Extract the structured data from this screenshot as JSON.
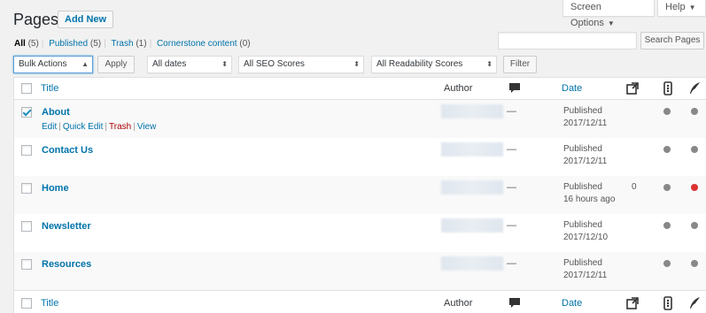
{
  "header": {
    "title": "Pages",
    "add_new": "Add New",
    "screen_options": "Screen Options",
    "help": "Help"
  },
  "views": {
    "all": "All",
    "all_count": "(5)",
    "published": "Published",
    "published_count": "(5)",
    "trash": "Trash",
    "trash_count": "(1)",
    "cornerstone": "Cornerstone content",
    "cornerstone_count": "(0)"
  },
  "search": {
    "button": "Search Pages",
    "value": ""
  },
  "filters": {
    "bulk_actions": "Bulk Actions",
    "apply": "Apply",
    "dates": "All dates",
    "seo": "All SEO Scores",
    "readability": "All Readability Scores",
    "filter": "Filter"
  },
  "columns": {
    "title": "Title",
    "author": "Author",
    "date": "Date",
    "comments_icon": "comment-bubble-icon",
    "links_icon": "outgoing-links-icon",
    "seo_icon": "seo-score-icon",
    "readability_icon": "readability-quill-icon"
  },
  "row_actions": {
    "edit": "Edit",
    "quick_edit": "Quick Edit",
    "trash": "Trash",
    "view": "View"
  },
  "rows": [
    {
      "title": "About",
      "checked": true,
      "comments": "—",
      "status": "Published",
      "date": "2017/12/11",
      "links": "",
      "seo": "#888888",
      "readability": "#888888"
    },
    {
      "title": "Contact Us",
      "checked": false,
      "comments": "—",
      "status": "Published",
      "date": "2017/12/11",
      "links": "",
      "seo": "#888888",
      "readability": "#888888"
    },
    {
      "title": "Home",
      "checked": false,
      "comments": "—",
      "status": "Published",
      "date": "16 hours ago",
      "links": "0",
      "seo": "#888888",
      "readability": "#dc3232"
    },
    {
      "title": "Newsletter",
      "checked": false,
      "comments": "—",
      "status": "Published",
      "date": "2017/12/10",
      "links": "",
      "seo": "#888888",
      "readability": "#888888"
    },
    {
      "title": "Resources",
      "checked": false,
      "comments": "—",
      "status": "Published",
      "date": "2017/12/11",
      "links": "",
      "seo": "#888888",
      "readability": "#888888"
    }
  ],
  "colors": {
    "link": "#0073aa",
    "score_gray": "#888888",
    "score_red": "#dc3232",
    "trash": "#aa0000"
  }
}
